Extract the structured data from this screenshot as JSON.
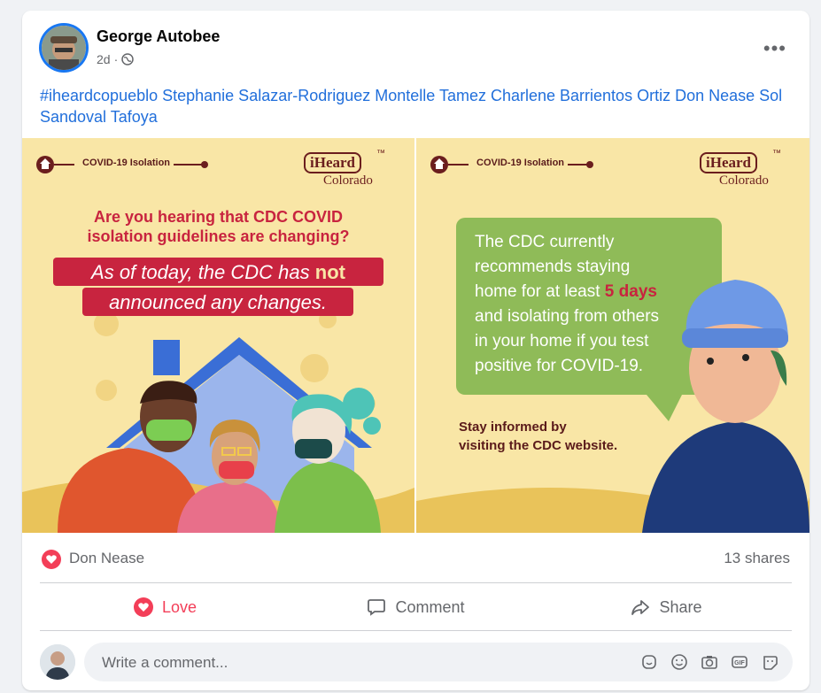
{
  "post": {
    "author": "George Autobee",
    "time": "2d",
    "separator": "·",
    "text": "#iheardcopueblo Stephanie Salazar-Rodriguez Montelle Tamez Charlene Barrientos Ortiz Don Nease Sol Sandoval Tafoya",
    "more_label": "•••"
  },
  "image1": {
    "tag": "COVID-19 Isolation",
    "brand": "iHeard",
    "brand_sub": "Colorado",
    "brand_tm": "™",
    "question_line1": "Are you hearing that CDC COVID",
    "question_line2": "isolation guidelines are changing?",
    "answer_line1_pre": "As of today, the CDC has ",
    "answer_line1_bold": "not",
    "answer_line2": "announced any changes."
  },
  "image2": {
    "tag": "COVID-19 Isolation",
    "brand": "iHeard",
    "brand_sub": "Colorado",
    "brand_tm": "™",
    "bubble_line1": "The CDC currently",
    "bubble_line2": "recommends staying",
    "bubble_line3_pre": "home for at least ",
    "bubble_line3_bold": "5 days",
    "bubble_line4": "and isolating from others",
    "bubble_line5": "in your home if you test",
    "bubble_line6": "positive for COVID-19.",
    "footer_line1": "Stay informed by",
    "footer_line2": "visiting the CDC website."
  },
  "reactions": {
    "name": "Don Nease",
    "shares": "13 shares"
  },
  "actions": {
    "love": "Love",
    "comment": "Comment",
    "share": "Share"
  },
  "comment_box": {
    "placeholder": "Write a comment..."
  },
  "colors": {
    "link": "#216fdb",
    "love": "#f33e58",
    "image_bg": "#f9e6a6",
    "title_red": "#c8243f",
    "bubble_green": "#8fbb58"
  },
  "icons": [
    "globe-icon",
    "heart-icon",
    "comment-icon",
    "share-icon",
    "sticker-icon",
    "emoji-icon",
    "camera-icon",
    "gif-icon",
    "avatar-sticker-icon",
    "home-icon"
  ]
}
